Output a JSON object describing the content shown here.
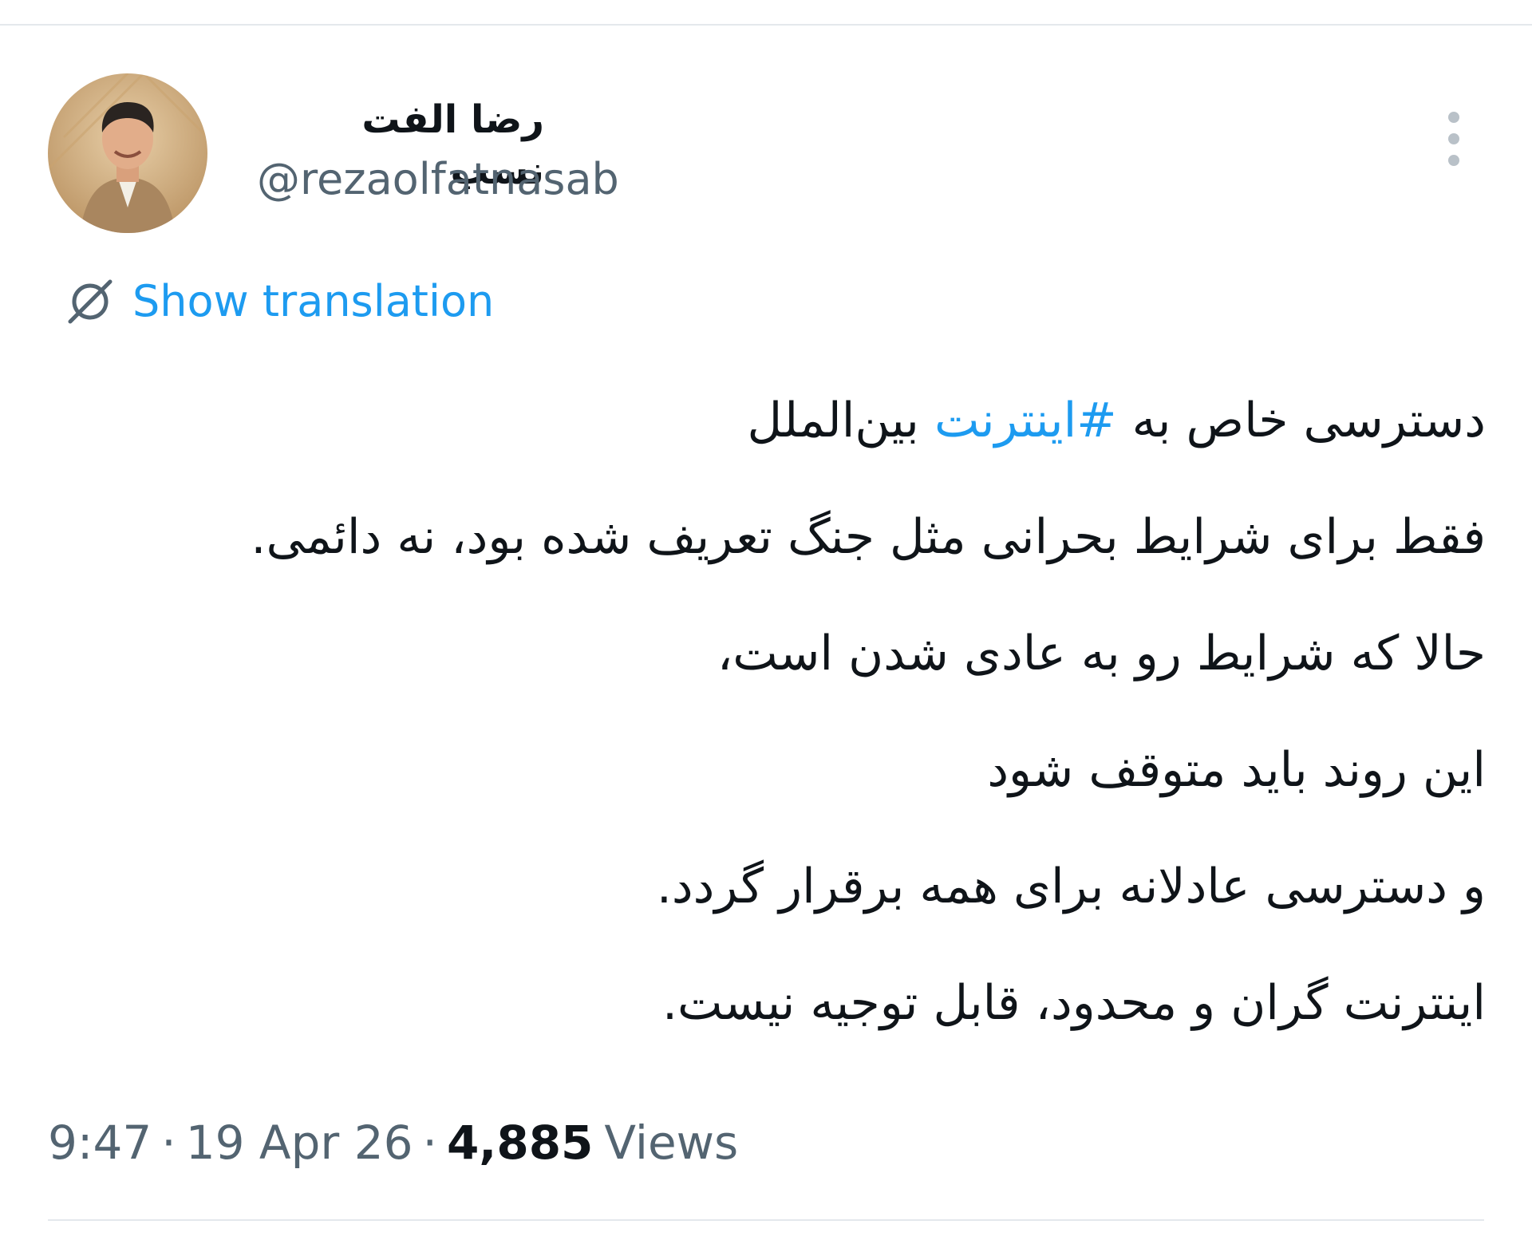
{
  "author": {
    "display_name": "رضا الفت نسب",
    "handle": "@rezaolfatnasab",
    "avatar_icon": "user-portrait"
  },
  "more_icon": "more-vertical-icon",
  "translation": {
    "icon": "globe-translate-icon",
    "label": "Show translation"
  },
  "tweet": {
    "lines": [
      {
        "before": "دسترسی خاص به ",
        "hashtag": "#اینترنت",
        "after": " بین‌الملل"
      },
      "فقط برای شرایط بحرانی مثل جنگ تعریف شده بود، نه دائمی.",
      "حالا که شرایط رو به عادی شدن است،",
      "این روند باید متوقف شود",
      "و دسترسی عادلانه برای همه برقرار گردد.",
      "اینترنت گران و محدود، قابل توجیه نیست."
    ]
  },
  "meta": {
    "time": "9:47",
    "separator": "·",
    "date": "19 Apr 26",
    "views_count": "4,885",
    "views_label": "Views"
  },
  "colors": {
    "link": "#1d9bf0",
    "text": "#0f1419",
    "muted": "#536471",
    "divider": "#e4e8ec"
  }
}
